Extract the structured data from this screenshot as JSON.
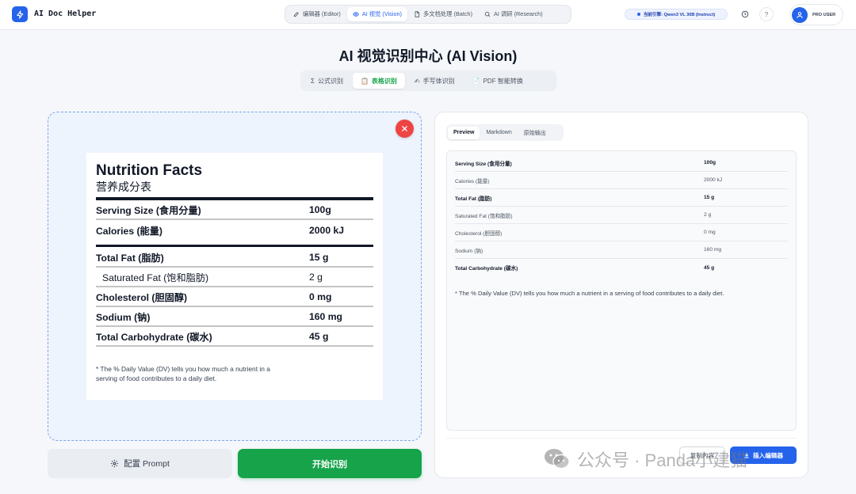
{
  "colors": {
    "accent": "#2563eb",
    "success": "#16a34a",
    "danger": "#ef4444"
  },
  "header": {
    "app_title": "AI Doc Helper",
    "nav": [
      {
        "label": "编辑器 (Editor)",
        "icon": "edit-icon",
        "active": false
      },
      {
        "label": "AI 视觉 (Vision)",
        "icon": "eye-icon",
        "active": true
      },
      {
        "label": "多文档处理 (Batch)",
        "icon": "file-icon",
        "active": false
      },
      {
        "label": "AI 调研 (Research)",
        "icon": "search-icon",
        "active": false
      }
    ],
    "engine": "当前引擎: Qwen3 VL 30B (Instruct)",
    "help_label": "?",
    "user_name": "PRO USER"
  },
  "page": {
    "title": "AI 视觉识别中心 (AI Vision)",
    "tabs": [
      {
        "icon_text": "Σ",
        "label": "公式识别",
        "active": false
      },
      {
        "icon_text": "📋",
        "label": "表格识别",
        "active": true
      },
      {
        "icon_text": "✍",
        "label": "手写体识别",
        "active": false
      },
      {
        "icon_text": "📄",
        "label": "PDF 智能转换",
        "active": false
      }
    ]
  },
  "image": {
    "title": "Nutrition Facts",
    "subtitle": "营养成分表",
    "rows": [
      {
        "label": "Serving Size (食用分量)",
        "value": "100g"
      },
      {
        "label": "Calories (能量)",
        "value": "2000 kJ"
      },
      {
        "label": "Total Fat (脂肪)",
        "value": "15 g"
      },
      {
        "label": "Saturated Fat (饱和脂肪)",
        "value": "2 g"
      },
      {
        "label": "Cholesterol (胆固醇)",
        "value": "0 mg"
      },
      {
        "label": "Sodium (钠)",
        "value": "160 mg"
      },
      {
        "label": "Total Carbohydrate (碳水)",
        "value": "45 g"
      }
    ],
    "note": "* The % Daily Value (DV) tells you how much a nutrient in a serving of food contributes to a daily diet."
  },
  "left_actions": {
    "prompt_label": "配置 Prompt",
    "start_label": "开始识别"
  },
  "result": {
    "tabs": [
      {
        "label": "Preview",
        "active": true
      },
      {
        "label": "Markdown",
        "active": false
      },
      {
        "label": "原始输出",
        "active": false
      }
    ],
    "rows": [
      {
        "label": "Serving Size (食用分量)",
        "value": "100g",
        "bold": true
      },
      {
        "label": "Calories (能量)",
        "value": "2000 kJ",
        "bold": false
      },
      {
        "label": "Total Fat (脂肪)",
        "value": "15 g",
        "bold": true
      },
      {
        "label": "Saturated Fat (饱和脂肪)",
        "value": "2 g",
        "bold": false
      },
      {
        "label": "Cholesterol (胆固醇)",
        "value": "0 mg",
        "bold": false
      },
      {
        "label": "Sodium (钠)",
        "value": "160 mg",
        "bold": false
      },
      {
        "label": "Total Carbohydrate (碳水)",
        "value": "45 g",
        "bold": true
      }
    ],
    "note": "* The % Daily Value (DV) tells you how much a nutrient in a serving of food contributes to a daily diet.",
    "copy_label": "复制内容",
    "insert_label": "插入编辑器"
  },
  "watermark": "公众号 · Panda小建猫"
}
